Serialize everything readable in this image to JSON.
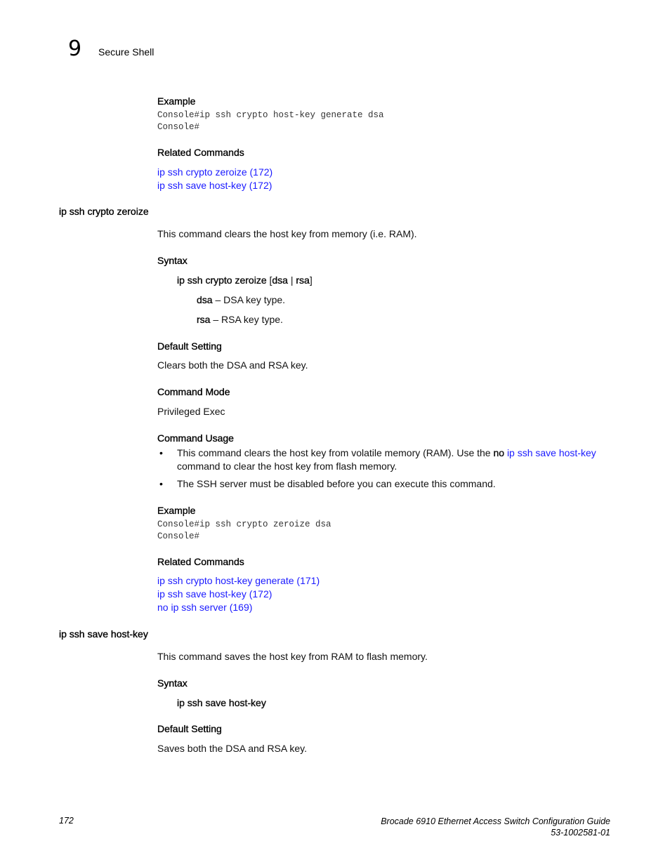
{
  "header": {
    "chapter_number": "9",
    "chapter_title": "Secure Shell"
  },
  "top_example": {
    "heading": "Example",
    "code": [
      "Console#ip ssh crypto host-key generate dsa",
      "Console#"
    ]
  },
  "top_related": {
    "heading": "Related Commands",
    "links": [
      "ip ssh crypto zeroize (172)",
      "ip ssh save host-key (172)"
    ]
  },
  "zeroize": {
    "title": "ip ssh crypto zeroize",
    "description": "This command clears the host key from memory (i.e. RAM).",
    "syntax_heading": "Syntax",
    "syntax": {
      "cmd": "ip ssh crypto zeroize ",
      "open": "[",
      "opt1": "dsa",
      "sep": " | ",
      "opt2": "rsa",
      "close": "]"
    },
    "params": [
      {
        "name": "dsa",
        "desc": " – DSA key type."
      },
      {
        "name": "rsa",
        "desc": " – RSA key type."
      }
    ],
    "default_heading": "Default Setting",
    "default": "Clears both the DSA and RSA key.",
    "mode_heading": "Command Mode",
    "mode": "Privileged Exec",
    "usage_heading": "Command Usage",
    "usage": {
      "b1_part1": "This command clears the host key from volatile memory (RAM). Use the ",
      "b1_no": "no",
      "b1_link": "ip ssh save host-key",
      "b1_line2": "command to clear the host key from flash memory.",
      "b2": "The SSH server must be disabled before you can execute this command.",
      "bullet": "•"
    },
    "example_heading": "Example",
    "code": [
      "Console#ip ssh crypto zeroize dsa",
      "Console#"
    ],
    "related_heading": "Related Commands",
    "related": [
      "ip ssh crypto host-key generate (171)",
      "ip ssh save host-key (172)",
      "no ip ssh server (169)"
    ]
  },
  "savekey": {
    "title": "ip ssh save host-key",
    "description": "This command saves the host key from RAM to flash memory.",
    "syntax_heading": "Syntax",
    "syntax": "ip ssh save host-key",
    "default_heading": "Default Setting",
    "default": "Saves both the DSA and RSA key."
  },
  "footer": {
    "page_number": "172",
    "doc_title": "Brocade 6910 Ethernet Access Switch Configuration Guide",
    "doc_number": "53-1002581-01"
  },
  "colors": {
    "link": "#1a1aff",
    "text": "#000000",
    "code": "#333333"
  }
}
